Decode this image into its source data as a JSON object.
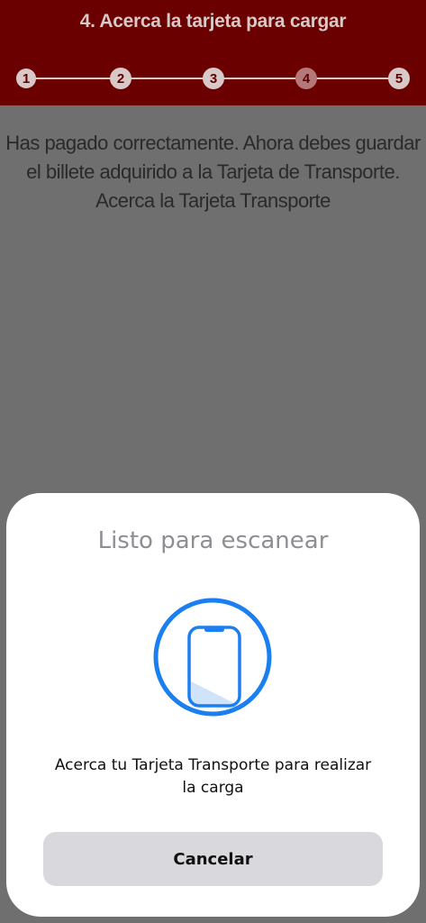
{
  "header": {
    "title": "4. Acerca la tarjeta para cargar",
    "steps": [
      "1",
      "2",
      "3",
      "4",
      "5"
    ],
    "current_step": 4
  },
  "instructions": {
    "line1": "Has pagado correctamente. Ahora debes guardar",
    "line2": "el billete adquirido a la Tarjeta de Transporte.",
    "line3": "Acerca la Tarjeta Transporte"
  },
  "scan_sheet": {
    "title": "Listo para escanear",
    "icon": "phone-scan-icon",
    "message_line1": "Acerca tu Tarjeta Transporte para realizar",
    "message_line2": "la carga",
    "cancel_label": "Cancelar"
  },
  "colors": {
    "header_bg": "#6b0000",
    "overlay_bg": "#6f6f6f",
    "accent_blue": "#1a7ff0",
    "button_bg": "#d8d8dd"
  }
}
